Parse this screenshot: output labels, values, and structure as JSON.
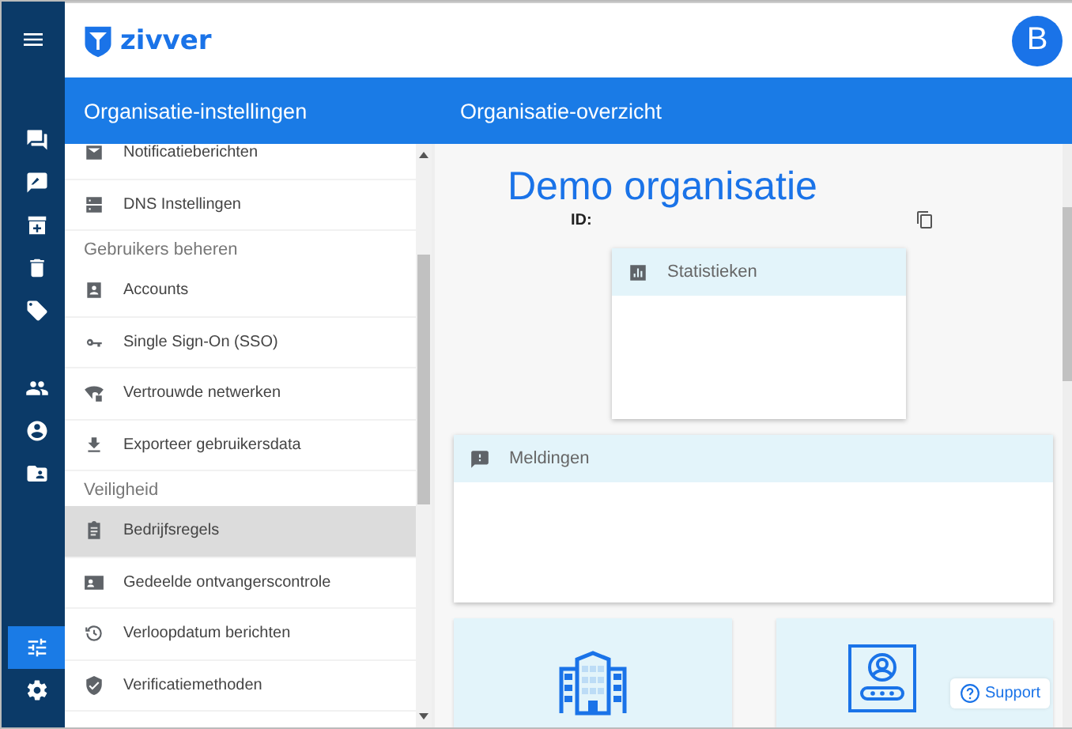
{
  "rail": {
    "items": [
      {
        "selected": false
      },
      {
        "selected": false
      },
      {
        "selected": false
      },
      {
        "selected": false
      },
      {
        "selected": false
      },
      {
        "selected": false
      },
      {
        "selected": false
      },
      {
        "selected": false
      },
      {
        "selected": true
      },
      {
        "selected": false
      }
    ]
  },
  "header": {
    "logo_text": "zivver",
    "avatar": "B"
  },
  "title_bar": {
    "left": "Organisatie-instellingen",
    "right": "Organisatie-overzicht"
  },
  "sidebar": {
    "sections": [
      {
        "items": [
          {
            "label": "Notificatieberichten",
            "selected": false
          },
          {
            "label": "DNS Instellingen",
            "selected": false
          }
        ]
      },
      {
        "title": "Gebruikers beheren",
        "items": [
          {
            "label": "Accounts",
            "selected": false
          },
          {
            "label": "Single Sign-On (SSO)",
            "selected": false
          },
          {
            "label": "Vertrouwde netwerken",
            "selected": false
          },
          {
            "label": "Exporteer gebruikersdata",
            "selected": false
          }
        ]
      },
      {
        "title": "Veiligheid",
        "items": [
          {
            "label": "Bedrijfsregels",
            "selected": true
          },
          {
            "label": "Gedeelde ontvangerscontrole",
            "selected": false
          },
          {
            "label": "Verloopdatum berichten",
            "selected": false
          },
          {
            "label": "Verificatiemethoden",
            "selected": false
          }
        ]
      }
    ]
  },
  "overview": {
    "org_name": "Demo organisatie",
    "id_label": "ID:",
    "statistics": {
      "title": "Statistieken"
    },
    "notifications": {
      "title": "Meldingen"
    },
    "support_button": "Support"
  }
}
